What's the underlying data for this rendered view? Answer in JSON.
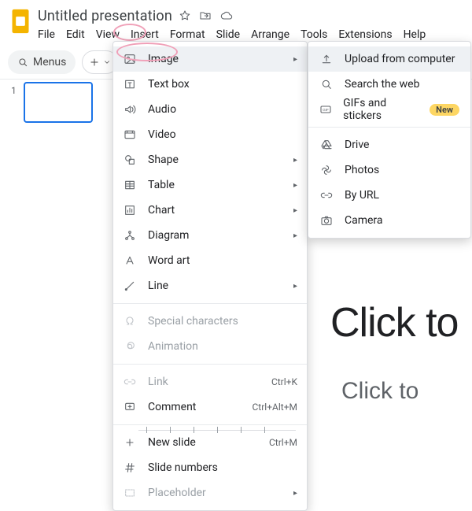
{
  "header": {
    "title": "Untitled presentation",
    "menus": [
      "File",
      "Edit",
      "View",
      "Insert",
      "Format",
      "Slide",
      "Arrange",
      "Tools",
      "Extensions",
      "Help"
    ]
  },
  "toolbar": {
    "menus_label": "Menus"
  },
  "slide": {
    "number": "1"
  },
  "insert_menu": {
    "image": "Image",
    "textbox": "Text box",
    "audio": "Audio",
    "video": "Video",
    "shape": "Shape",
    "table": "Table",
    "chart": "Chart",
    "diagram": "Diagram",
    "wordart": "Word art",
    "line": "Line",
    "special": "Special characters",
    "animation": "Animation",
    "link": "Link",
    "link_kbd": "Ctrl+K",
    "comment": "Comment",
    "comment_kbd": "Ctrl+Alt+M",
    "newslide": "New slide",
    "newslide_kbd": "Ctrl+M",
    "slidenums": "Slide numbers",
    "placeholder": "Placeholder"
  },
  "image_submenu": {
    "upload": "Upload from computer",
    "search": "Search the web",
    "gifs": "GIFs and stickers",
    "gifs_badge": "New",
    "drive": "Drive",
    "photos": "Photos",
    "url": "By URL",
    "camera": "Camera"
  },
  "canvas": {
    "title_placeholder": "Click to",
    "subtitle_placeholder": "Click to"
  }
}
